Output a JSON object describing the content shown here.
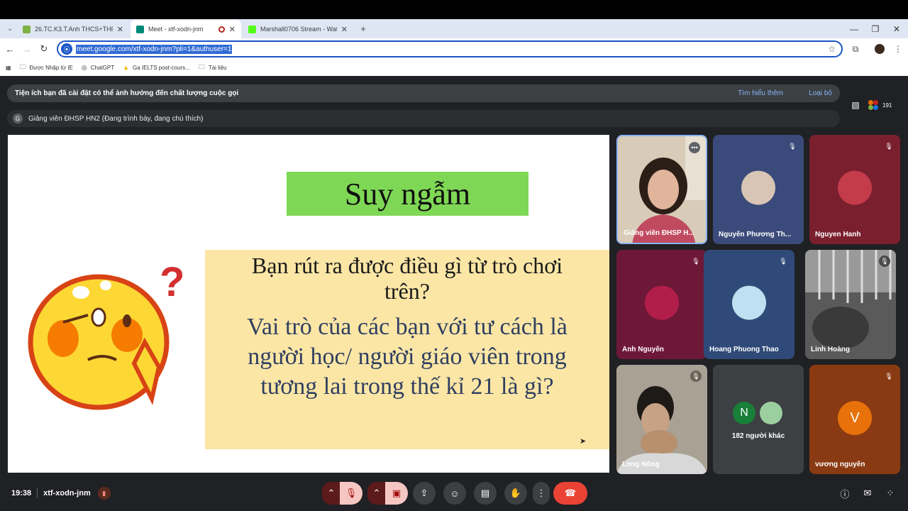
{
  "browser": {
    "tabs": [
      {
        "title": "26.TC.K3.T.Anh THCS+THPT – L",
        "color": "#7cb342"
      },
      {
        "title": "Meet - xtf-xodn-jnm",
        "color": "#00897b"
      },
      {
        "title": "Marshall0706 Stream - Watch L",
        "color": "#53fc18"
      }
    ],
    "url": "meet.google.com/xtf-xodn-jnm?pli=1&authuser=1",
    "bookmarks": [
      {
        "label": "Được Nhập từ IE",
        "icon": "📁"
      },
      {
        "label": "ChatGPT",
        "icon": "◎"
      },
      {
        "label": "Ga IELTS post-cours...",
        "icon": "▲"
      },
      {
        "label": "Tài liệu",
        "icon": "📁"
      }
    ]
  },
  "meet": {
    "banner_text": "Tiện ích bạn đã cài đặt có thể ảnh hưởng đến chất lượng cuộc gọi",
    "banner_learn": "Tìm hiểu thêm",
    "banner_remove": "Loại bỏ",
    "presenter_initial": "G",
    "presenter_text": "Giảng viên ĐHSP HN2 (Đang trình bày, đang chú thích)",
    "participant_count": "191",
    "slide": {
      "title": "Suy ngẫm",
      "question1": "Bạn rút ra được điều gì từ trò chơi trên?",
      "question2": "Vai trò của các bạn với tư cách là người học/ người giáo viên trong tương lai trong thế kỉ 21 là gì?"
    },
    "participants": [
      {
        "name": "Giảng viên ĐHSP H...",
        "bg": "#c9b8a3",
        "muted": false
      },
      {
        "name": "Nguyễn Phương Th...",
        "bg": "#3a4a7a",
        "muted": true
      },
      {
        "name": "Nguyen Hanh",
        "bg": "#7a1f2e",
        "muted": true
      },
      {
        "name": "Ánh Nguyễn",
        "bg": "#6e1838",
        "muted": true
      },
      {
        "name": "Hoang Phuong Thao",
        "bg": "#2f4a78",
        "muted": true
      },
      {
        "name": "Linh Hoàng",
        "bg": "#4a4a4a",
        "muted": true
      },
      {
        "name": "Long Nông",
        "bg": "#8a8378",
        "muted": true
      },
      {
        "name": "182 người khác",
        "bg": "#3c4043",
        "muted": false,
        "initial": "N"
      },
      {
        "name": "vương nguyễn",
        "bg": "#8a3a12",
        "muted": true,
        "initial": "V"
      }
    ],
    "time": "19:38",
    "meeting_code": "xtf-xodn-jnm"
  }
}
